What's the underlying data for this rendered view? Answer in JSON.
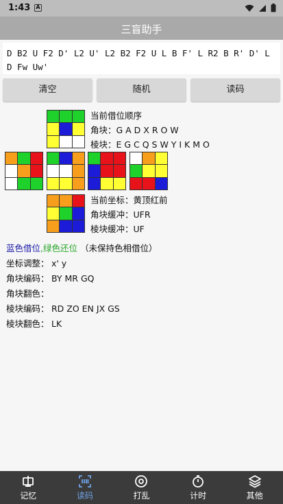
{
  "status": {
    "time": "1:43",
    "notification_icon": "a-icon"
  },
  "app": {
    "title": "三盲助手"
  },
  "formula": "D B2 U F2 D' L2 U' L2 B2 F2 U L B F' L R2 B R' D' L D Fw Uw'",
  "buttons": {
    "clear": "清空",
    "random": "随机",
    "read": "读码"
  },
  "colors": {
    "W": "#ffffff",
    "Y": "#ffff33",
    "G": "#1fd12b",
    "B": "#1c1cd8",
    "R": "#e8121a",
    "O": "#f79f1d",
    "accent": "#6fa3e8",
    "blue_text": "#1a1aa8",
    "green_text": "#2aa52a"
  },
  "cube": {
    "up": [
      "G",
      "G",
      "G",
      "Y",
      "B",
      "Y",
      "Y",
      "W",
      "W"
    ],
    "left": [
      "O",
      "G",
      "R",
      "W",
      "O",
      "R",
      "W",
      "G",
      "G"
    ],
    "front": [
      "G",
      "B",
      "O",
      "W",
      "W",
      "O",
      "Y",
      "Y",
      "O"
    ],
    "right": [
      "G",
      "R",
      "R",
      "B",
      "R",
      "R",
      "B",
      "Y",
      "Y"
    ],
    "back": [
      "W",
      "O",
      "Y",
      "G",
      "Y",
      "Y",
      "R",
      "R",
      "B"
    ],
    "down": [
      "O",
      "O",
      "R",
      "Y",
      "G",
      "B",
      "O",
      "B",
      "B"
    ]
  },
  "info_top": {
    "order_label": "当前借位顺序",
    "corner_order": "角块：G A D X R O W",
    "edge_order": "棱块：E G C Q S W Y I K M O"
  },
  "info_bottom": {
    "coord": "当前坐标：黄顶红前",
    "corner_buffer": "角块缓冲：UFR",
    "edge_buffer": "棱块缓冲：UF"
  },
  "legend": {
    "blue": "蓝色借位",
    "sep": ",",
    "green": "绿色还位",
    "note": " （未保持色相借位）"
  },
  "details": [
    {
      "label": "坐标调整：",
      "value": "x' y"
    },
    {
      "label": "角块编码：",
      "value": "BY  MR  GQ"
    },
    {
      "label": "角块翻色：",
      "value": ""
    },
    {
      "label": "棱块编码：",
      "value": "RD  ZO  EN  JX  GS"
    },
    {
      "label": "棱块翻色：",
      "value": "LK"
    }
  ],
  "nav": [
    {
      "label": "记忆",
      "icon": "memory-icon"
    },
    {
      "label": "读码",
      "icon": "scan-code-icon",
      "active": true
    },
    {
      "label": "打乱",
      "icon": "scramble-icon"
    },
    {
      "label": "计时",
      "icon": "timer-icon"
    },
    {
      "label": "其他",
      "icon": "layers-icon"
    }
  ]
}
